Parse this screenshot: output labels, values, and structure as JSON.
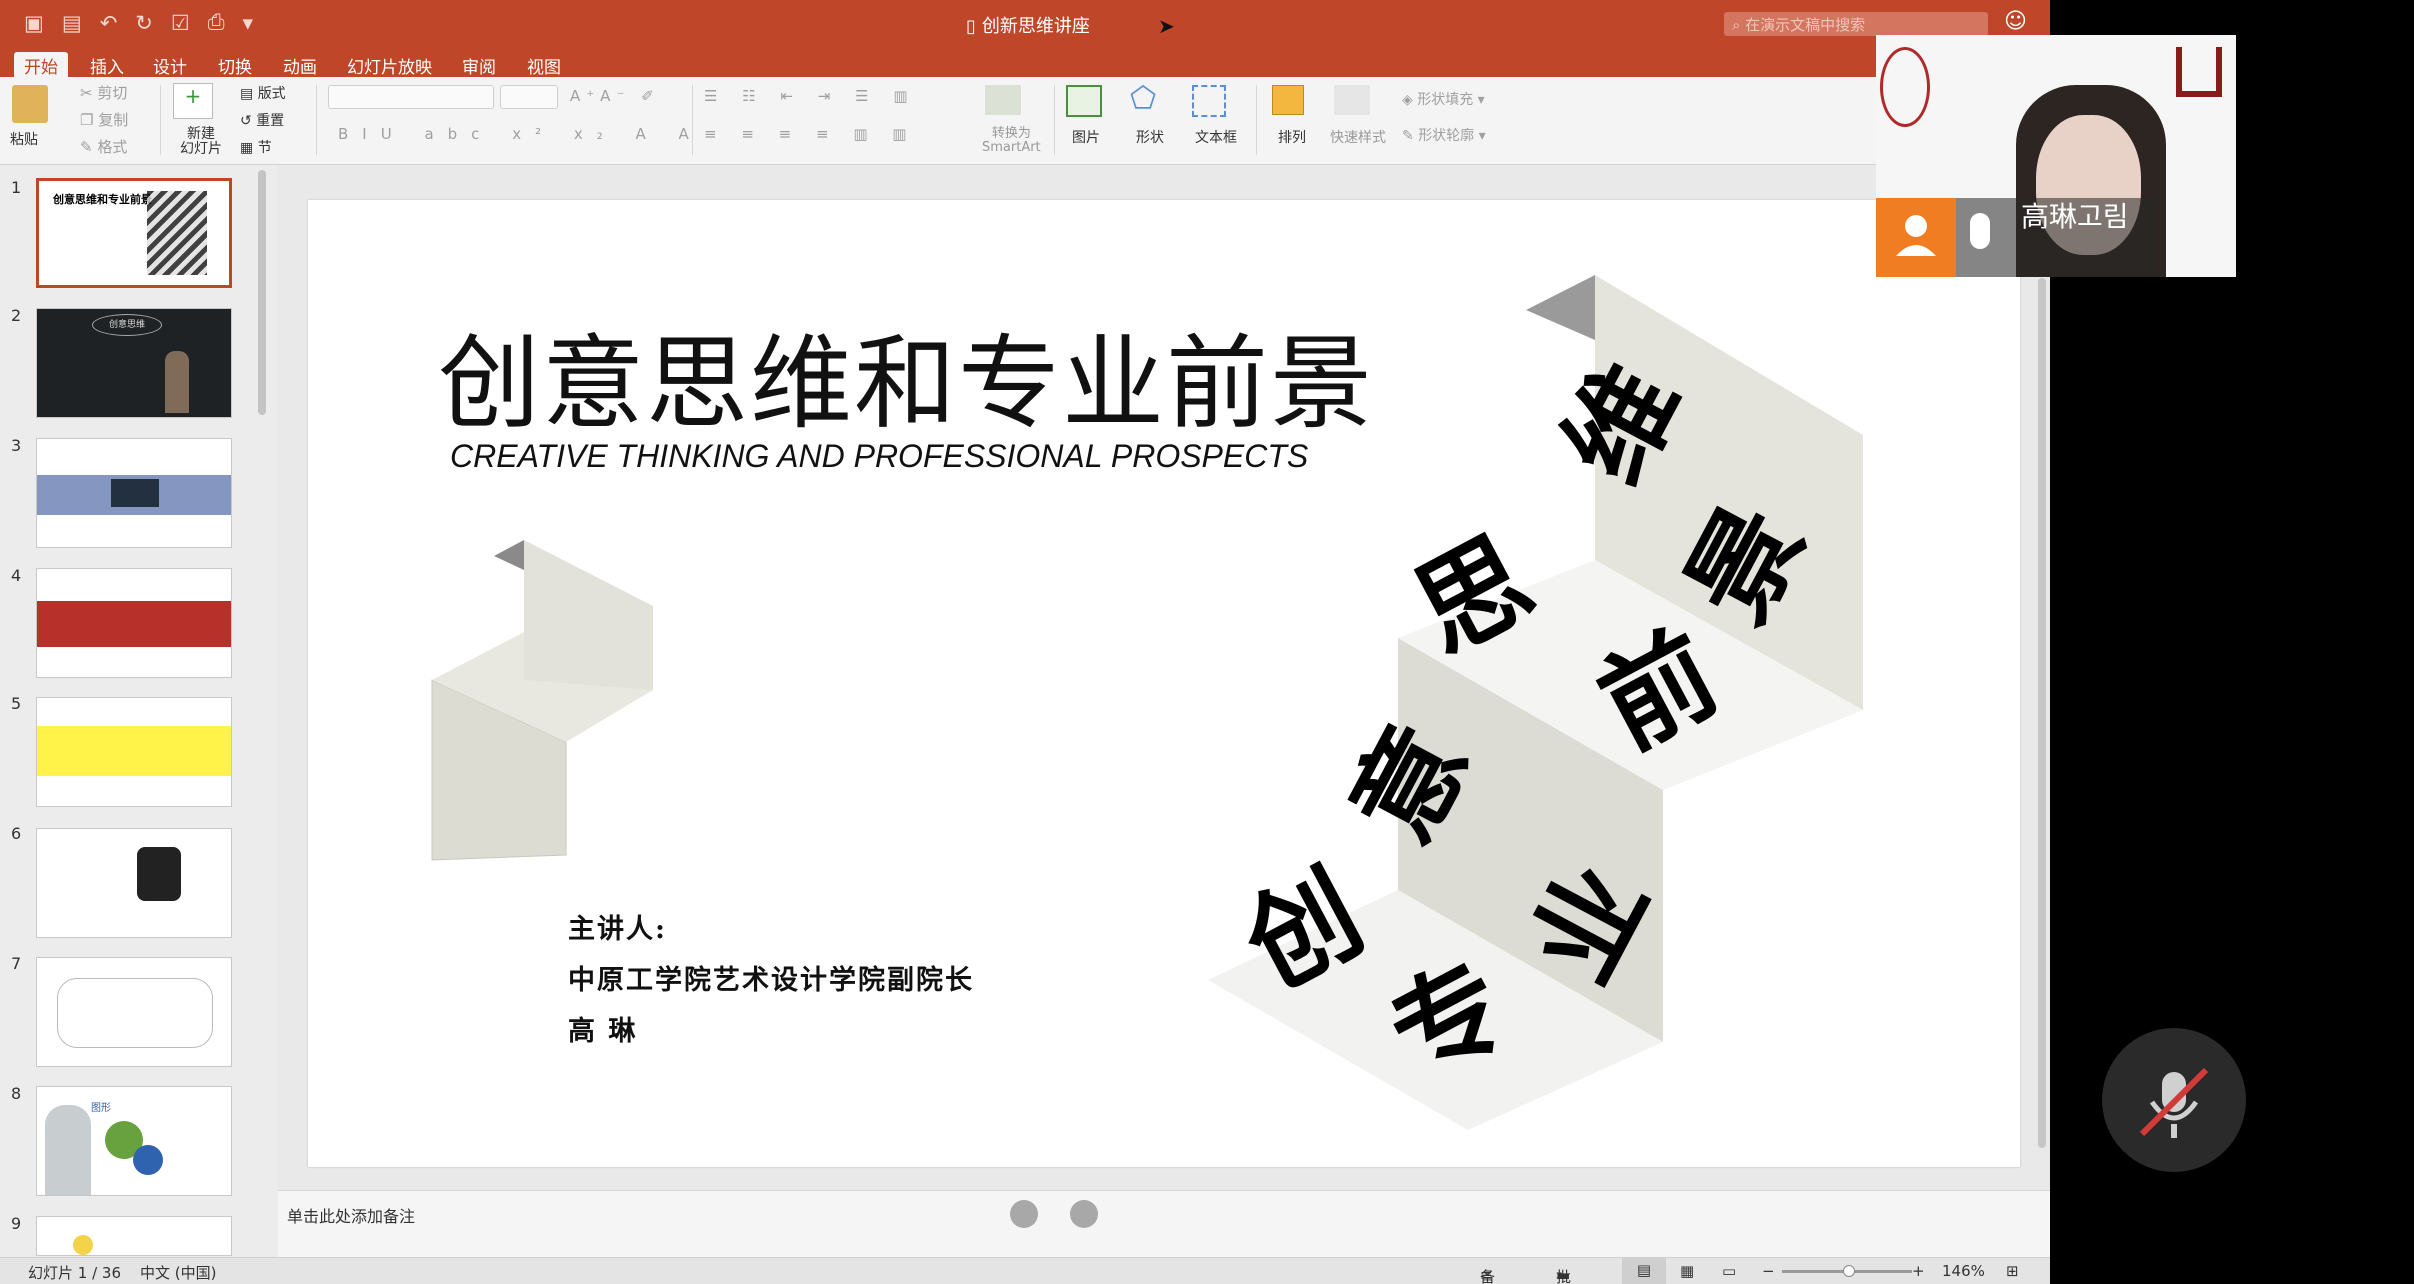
{
  "app": {
    "document_title": "创新思维讲座",
    "search_placeholder": "在演示文稿中搜索"
  },
  "ribbon_tabs": [
    "开始",
    "插入",
    "设计",
    "切换",
    "动画",
    "幻灯片放映",
    "审阅",
    "视图"
  ],
  "ribbon": {
    "paste": "粘贴",
    "cut": "剪切",
    "copy": "复制",
    "format": "格式",
    "new_slide_1": "新建",
    "new_slide_2": "幻灯片",
    "layout": "版式",
    "reset": "重置",
    "section": "节",
    "convert_1": "转换为",
    "convert_2": "SmartArt",
    "picture": "图片",
    "shape": "形状",
    "textbox": "文本框",
    "arrange": "排列",
    "quick_styles": "快速样式",
    "shape_fill": "形状填充",
    "shape_outline": "形状轮廓"
  },
  "slide": {
    "title": "创意思维和专业前景",
    "subtitle": "CREATIVE THINKING AND PROFESSIONAL PROSPECTS",
    "speaker_label": "主讲人:",
    "speaker_title": "中原工学院艺术设计学院副院长",
    "speaker_name": "高 琳",
    "art_chars": [
      "维",
      "景",
      "思",
      "前",
      "意",
      "业",
      "创",
      "专"
    ]
  },
  "thumbnails": [
    {
      "num": "1",
      "text": "创意思维和专业前景"
    },
    {
      "num": "2",
      "text": "创意思维"
    },
    {
      "num": "3",
      "text": ""
    },
    {
      "num": "4",
      "text": ""
    },
    {
      "num": "5",
      "text": ""
    },
    {
      "num": "6",
      "text": ""
    },
    {
      "num": "7",
      "text": ""
    },
    {
      "num": "8",
      "text": "图形"
    },
    {
      "num": "9",
      "text": ""
    }
  ],
  "notes": {
    "placeholder": "单击此处添加备注"
  },
  "status": {
    "slide_pos": "幻灯片 1 / 36",
    "language": "中文 (中国)",
    "notes_btn": "备注",
    "comments_btn": "批注",
    "zoom": "146%"
  },
  "video": {
    "participant_name": "高琳고림"
  },
  "colors": {
    "accent": "#c0462a",
    "video_orange": "#f07d22"
  }
}
